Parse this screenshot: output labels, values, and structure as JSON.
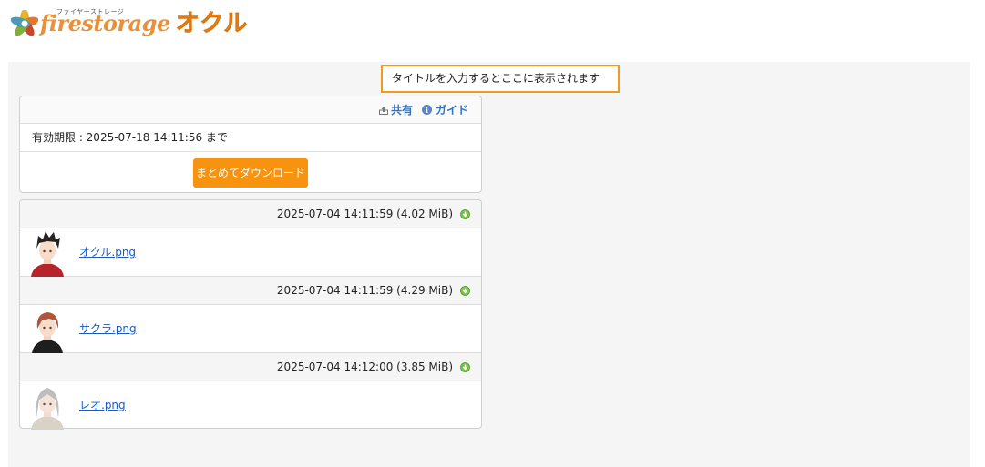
{
  "logo": {
    "brand": "firestorage",
    "sub": "ファイヤーストレージ",
    "product": "オクル"
  },
  "title_box": {
    "text": "タイトルを入力するとここに表示されます"
  },
  "toolbar": {
    "share_label": "共有",
    "guide_label": "ガイド"
  },
  "expiry": {
    "text": "有効期限 : 2025-07-18 14:11:56 まで"
  },
  "download_all_label": "まとめてダウンロード",
  "files": [
    {
      "meta": "2025-07-04 14:11:59 (4.02 MiB)",
      "name": "オクル.png"
    },
    {
      "meta": "2025-07-04 14:11:59 (4.29 MiB)",
      "name": "サクラ.png"
    },
    {
      "meta": "2025-07-04 14:12:00 (3.85 MiB)",
      "name": "レオ.png"
    }
  ],
  "colors": {
    "accent_orange": "#f7930f",
    "link_blue": "#2f73c9",
    "title_border": "#f39a1e"
  }
}
